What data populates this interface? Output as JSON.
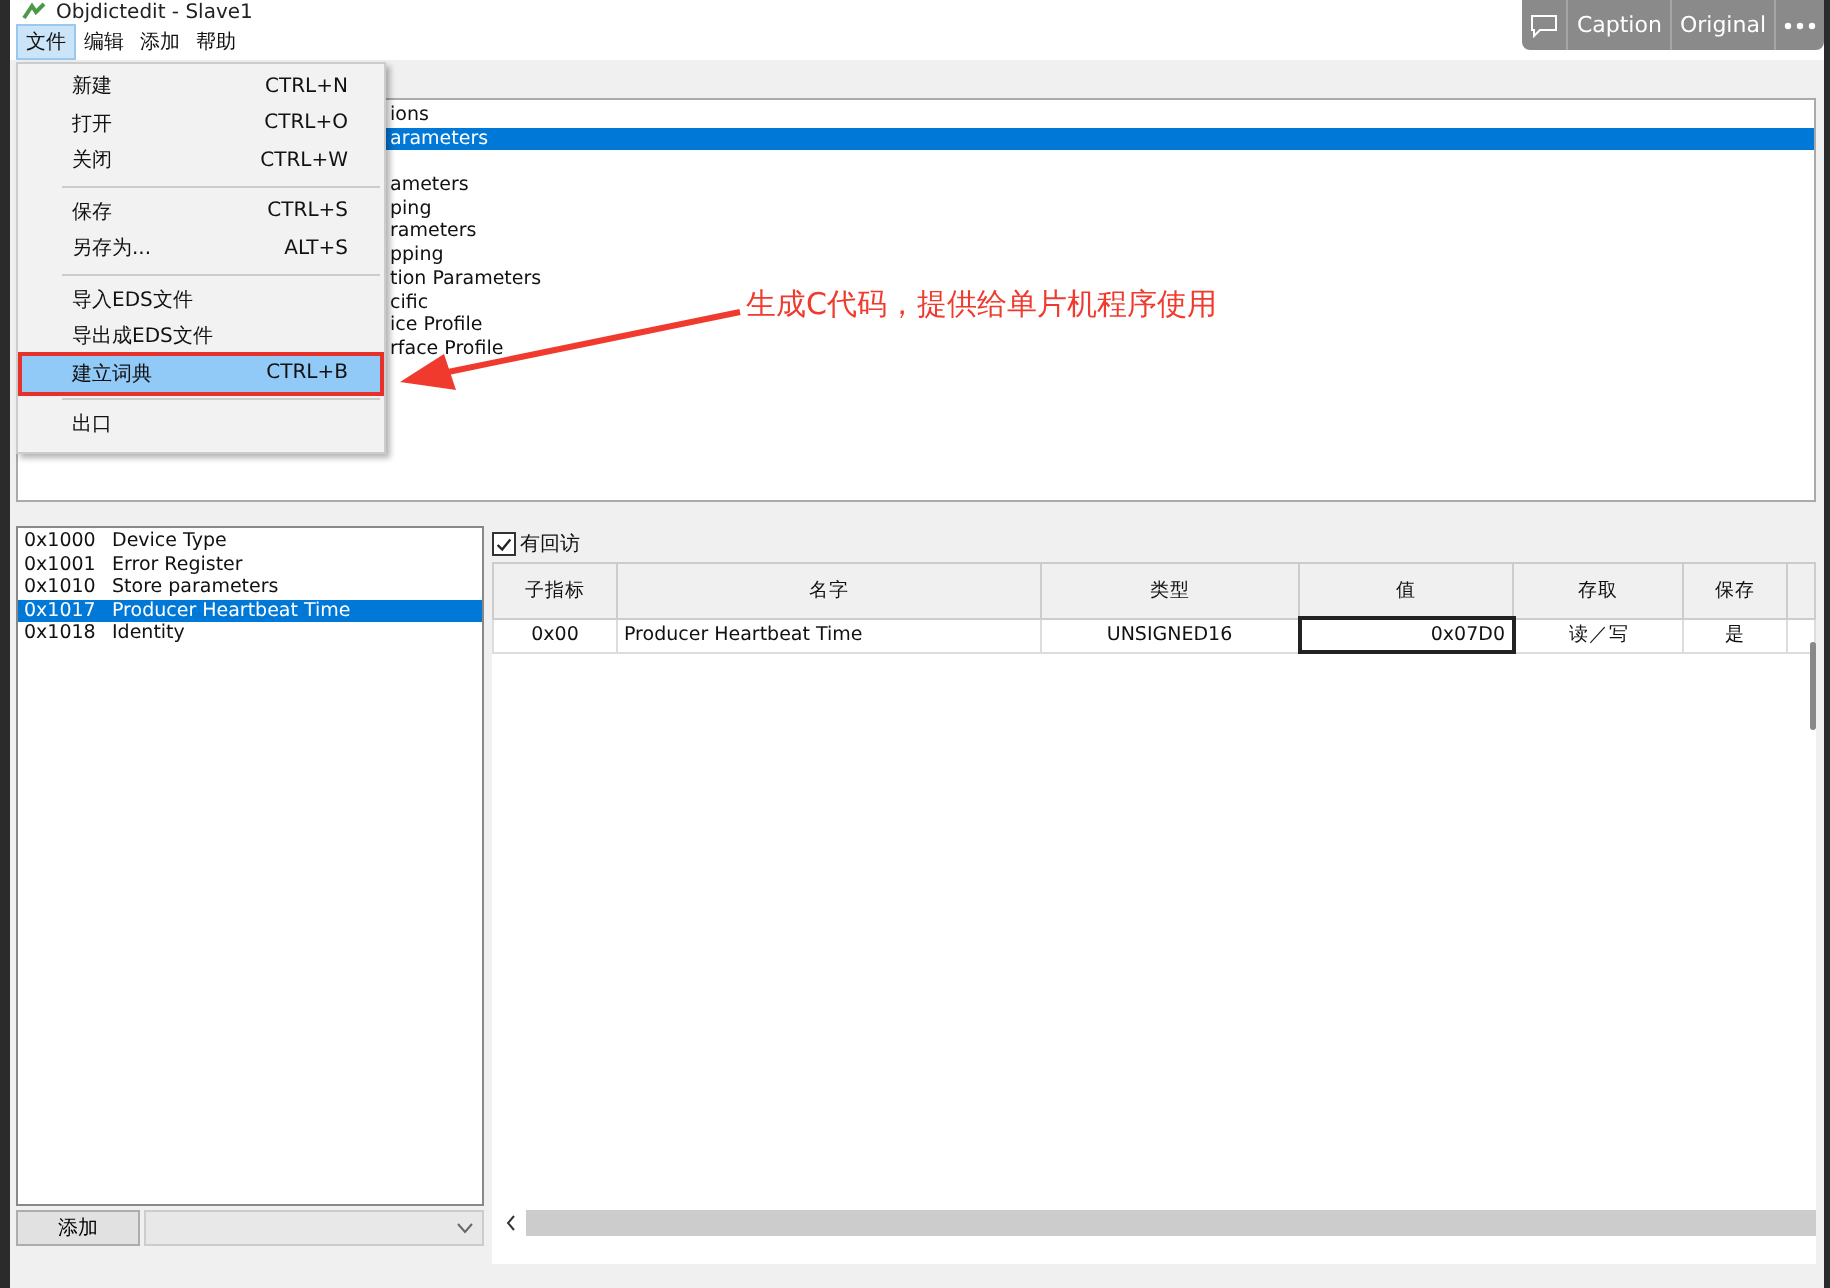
{
  "window": {
    "title": "Objdictedit - Slave1"
  },
  "menu_bar": [
    {
      "label": "文件",
      "selected": true
    },
    {
      "label": "编辑",
      "selected": false
    },
    {
      "label": "添加",
      "selected": false
    },
    {
      "label": "帮助",
      "selected": false
    }
  ],
  "file_menu": [
    {
      "kind": "item",
      "label": "新建",
      "shortcut": "CTRL+N",
      "selected": false
    },
    {
      "kind": "item",
      "label": "打开",
      "shortcut": "CTRL+O",
      "selected": false
    },
    {
      "kind": "item",
      "label": "关闭",
      "shortcut": "CTRL+W",
      "selected": false
    },
    {
      "kind": "separator"
    },
    {
      "kind": "item",
      "label": "保存",
      "shortcut": "CTRL+S",
      "selected": false
    },
    {
      "kind": "item",
      "label": "另存为...",
      "shortcut": "ALT+S",
      "selected": false
    },
    {
      "kind": "separator"
    },
    {
      "kind": "item",
      "label": "导入EDS文件",
      "selected": false
    },
    {
      "kind": "item",
      "label": "导出成EDS文件",
      "selected": false
    },
    {
      "kind": "item",
      "label": "建立词典",
      "shortcut": "CTRL+B",
      "selected": true,
      "highlighted": true
    },
    {
      "kind": "separator"
    },
    {
      "kind": "item",
      "label": "出口",
      "selected": false
    }
  ],
  "top_list": [
    {
      "text": "ions",
      "selected": false
    },
    {
      "text": "arameters",
      "selected": true
    },
    {
      "text": "ameters",
      "selected": false
    },
    {
      "text": "ping",
      "selected": false
    },
    {
      "text": "rameters",
      "selected": false
    },
    {
      "text": "pping",
      "selected": false
    },
    {
      "text": "tion Parameters",
      "selected": false
    },
    {
      "text": "cific",
      "selected": false
    },
    {
      "text": "ice Profile",
      "selected": false
    },
    {
      "text": "rface Profile",
      "selected": false
    }
  ],
  "annotation": {
    "text": "生成C代码，提供给单片机程序使用"
  },
  "viewer_toolbar": [
    {
      "kind": "comment"
    },
    {
      "kind": "text",
      "label": "Caption"
    },
    {
      "kind": "text",
      "label": "Original"
    },
    {
      "kind": "more"
    }
  ],
  "index_list": [
    {
      "index": "0x1000",
      "name": "Device Type",
      "selected": false
    },
    {
      "index": "0x1001",
      "name": "Error Register",
      "selected": false
    },
    {
      "index": "0x1010",
      "name": "Store parameters",
      "selected": false
    },
    {
      "index": "0x1017",
      "name": "Producer Heartbeat Time",
      "selected": true
    },
    {
      "index": "0x1018",
      "name": "Identity",
      "selected": false
    }
  ],
  "add_button": "添加",
  "checkbox": {
    "label": "有回访",
    "checked": true
  },
  "table": {
    "columns": [
      "子指标",
      "名字",
      "类型",
      "值",
      "存取",
      "保存"
    ],
    "rows": [
      {
        "cells": [
          {
            "text": "0x00",
            "selected": false
          },
          {
            "text": "Producer Heartbeat Time",
            "selected": false
          },
          {
            "text": "UNSIGNED16",
            "selected": false
          },
          {
            "text": "0x07D0",
            "selected": true
          },
          {
            "text": "读／写",
            "selected": false
          },
          {
            "text": "是",
            "selected": false
          }
        ]
      }
    ]
  }
}
